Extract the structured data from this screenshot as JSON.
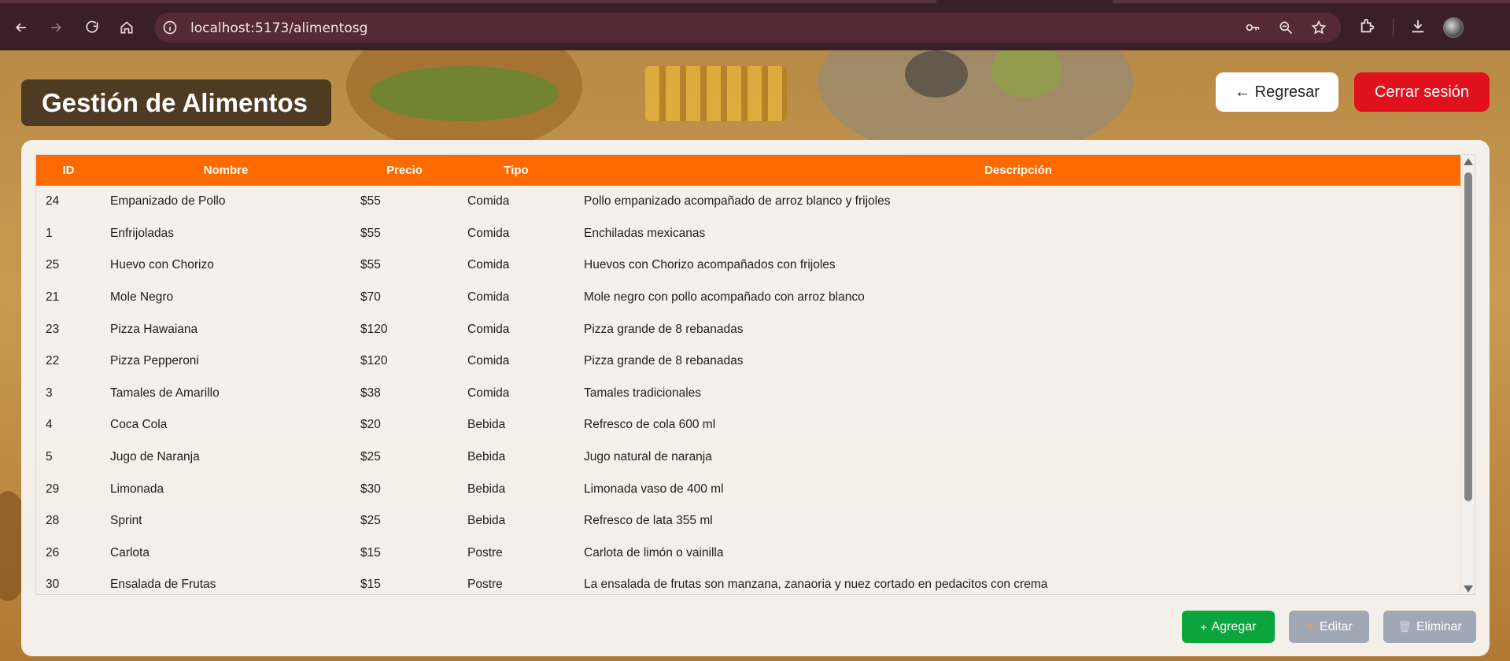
{
  "browser": {
    "url": "localhost:5173/alimentosg",
    "icons": [
      "back-icon",
      "forward-icon",
      "reload-icon",
      "home-icon",
      "site-info-icon",
      "password-key-icon",
      "zoom-icon",
      "bookmark-star-icon",
      "extensions-icon",
      "download-icon",
      "profile-avatar"
    ]
  },
  "header": {
    "title": "Gestión de Alimentos",
    "back_label": "← Regresar",
    "logout_label": "Cerrar sesión"
  },
  "table": {
    "columns": [
      "ID",
      "Nombre",
      "Precio",
      "Tipo",
      "Descripción"
    ],
    "rows": [
      [
        "24",
        "Empanizado de Pollo",
        "$55",
        "Comida",
        "Pollo empanizado acompañado de arroz blanco y frijoles"
      ],
      [
        "1",
        "Enfrijoladas",
        "$55",
        "Comida",
        "Enchiladas mexicanas"
      ],
      [
        "25",
        "Huevo con Chorizo",
        "$55",
        "Comida",
        "Huevos con Chorizo acompañados con frijoles"
      ],
      [
        "21",
        "Mole Negro",
        "$70",
        "Comida",
        "Mole negro con pollo acompañado con arroz blanco"
      ],
      [
        "23",
        "Pizza Hawaiana",
        "$120",
        "Comida",
        "Pizza grande de 8 rebanadas"
      ],
      [
        "22",
        "Pizza Pepperoni",
        "$120",
        "Comida",
        "Pizza grande de 8 rebanadas"
      ],
      [
        "3",
        "Tamales de Amarillo",
        "$38",
        "Comida",
        "Tamales tradicionales"
      ],
      [
        "4",
        "Coca Cola",
        "$20",
        "Bebida",
        "Refresco de cola 600 ml"
      ],
      [
        "5",
        "Jugo de Naranja",
        "$25",
        "Bebida",
        "Jugo natural de naranja"
      ],
      [
        "29",
        "Limonada",
        "$30",
        "Bebida",
        "Limonada vaso de 400 ml"
      ],
      [
        "28",
        "Sprint",
        "$25",
        "Bebida",
        "Refresco de lata 355 ml"
      ],
      [
        "26",
        "Carlota",
        "$15",
        "Postre",
        "Carlota de limón o vainilla"
      ],
      [
        "30",
        "Ensalada de Frutas",
        "$15",
        "Postre",
        "La ensalada de frutas son manzana, zanaoria y nuez cortado en pedacitos con crema"
      ]
    ]
  },
  "actions": {
    "add_label": "Agregar",
    "edit_label": "Editar",
    "delete_label": "Eliminar",
    "add_icon": "plus-icon",
    "edit_icon": "pencil-icon",
    "delete_icon": "trash-icon"
  },
  "colors": {
    "header_orange": "#ff6a00",
    "logout_red": "#e0101c",
    "add_green": "#0aa53c",
    "disabled_gray": "#a0a8b6",
    "chrome_bg": "#3b1f28"
  }
}
